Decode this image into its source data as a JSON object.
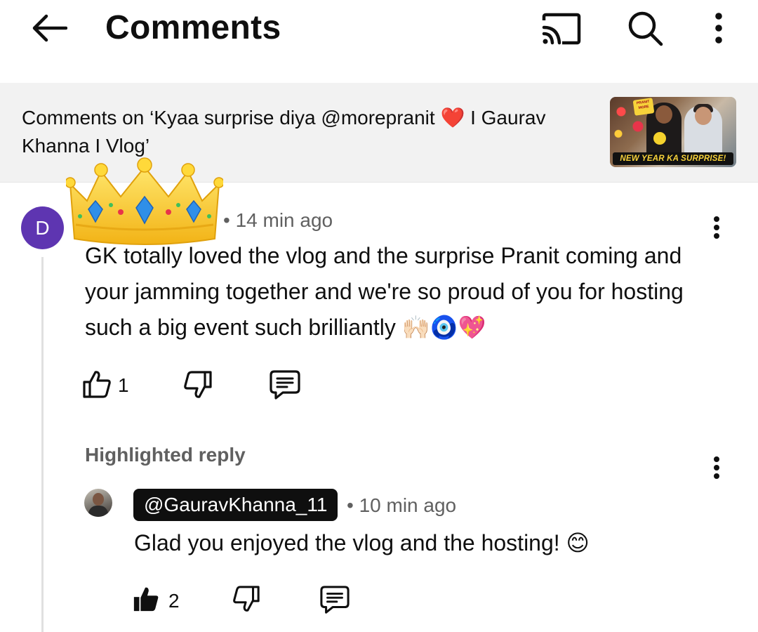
{
  "header": {
    "title": "Comments",
    "icons": {
      "back": "arrow-left-icon",
      "cast": "cast-icon",
      "search": "search-icon",
      "more": "more-vertical-icon"
    }
  },
  "video_context": {
    "prefix": "Comments on ‘Kyaa surprise diya @morepranit ",
    "heart": "❤️",
    "suffix": " I Gaurav Khanna I Vlog’",
    "thumbnail_banner": "NEW YEAR KA SURPRISE!",
    "thumbnail_badge": "PRANIT MORE"
  },
  "comment": {
    "avatar_letter": "D",
    "avatar_color": "#5e35b1",
    "sticker": "crown",
    "time": "• 14 min ago",
    "text": "GK totally loved the vlog and the surprise Pranit coming and your jamming together and we're so proud of you for hosting such a big event such brilliantly 🙌🏻🧿💖",
    "like_count": "1",
    "icons": {
      "like": "thumbs-up-icon",
      "dislike": "thumbs-down-icon",
      "reply": "reply-comment-icon",
      "more": "more-vertical-icon"
    }
  },
  "highlighted_reply": {
    "label": "Highlighted reply",
    "author": "@GauravKhanna_11",
    "time": "• 10 min ago",
    "text": "Glad you enjoyed the vlog and the hosting! 😊",
    "like_count": "2",
    "liked": true,
    "icons": {
      "like": "thumbs-up-filled-icon",
      "dislike": "thumbs-down-icon",
      "reply": "reply-comment-icon",
      "more": "more-vertical-icon"
    }
  },
  "colors": {
    "text_primary": "#0f0f0f",
    "text_secondary": "#606060",
    "context_bg": "#f2f2f2",
    "creator_chip_bg": "#0f0f0f"
  }
}
